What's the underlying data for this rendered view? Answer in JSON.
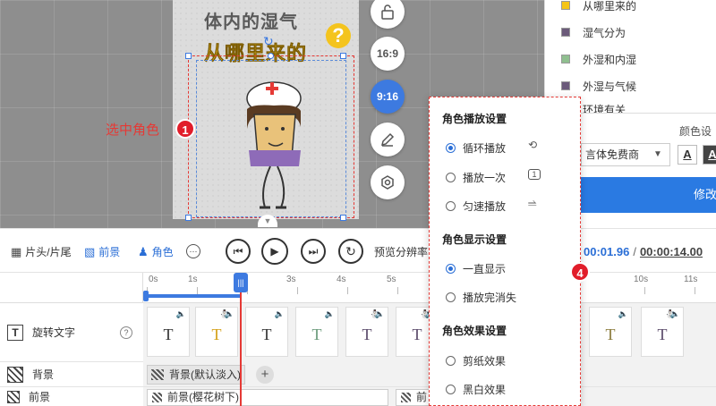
{
  "stage": {
    "title_line1": "体内的湿气",
    "title_line2": "从哪里来的",
    "question_mark": "?",
    "select_label": "选中角色",
    "badge1": "1"
  },
  "aspect_buttons": {
    "ratio_169": "16:9",
    "ratio_916": "9:16"
  },
  "right_panel": {
    "legend": [
      {
        "label": "从哪里来的",
        "color": "#f5c518"
      },
      {
        "label": "湿气分为",
        "color": "#6b5a7a"
      },
      {
        "label": "外湿和内湿",
        "color": "#8fbf8f"
      },
      {
        "label": "外湿与气候",
        "color": "#6b5a7a"
      },
      {
        "label": "环境有关",
        "color": "#6b5a7a"
      }
    ],
    "color_label": "颜色设",
    "font_value": "言体免费商",
    "font_style_a": "A",
    "apply_label": "修改"
  },
  "toolbar": {
    "header_footer": "片头/片尾",
    "foreground": "前景",
    "role": "角色",
    "more": "···",
    "preview_label": "预览分辨率",
    "current_time": "00:01.96",
    "separator": "/",
    "total_time": "00:00:14.00"
  },
  "timeline": {
    "ticks": [
      "0s",
      "1s",
      "3s",
      "4s",
      "5s",
      "10s",
      "11s"
    ],
    "playhead": "|||",
    "tracks": {
      "text": "旋转文字",
      "text_help": "?",
      "background": "背景",
      "foreground": "前景"
    },
    "text_clip_glyph": "T",
    "bg_clip": "背景(默认淡入)",
    "bg_add": "+",
    "fg_clip1": "前景(樱花树下)",
    "fg_clip2": "前"
  },
  "popup": {
    "section_play": "角色播放设置",
    "loop": "循环播放",
    "play_once": "播放一次",
    "uniform": "匀速播放",
    "section_display": "角色显示设置",
    "always_show": "一直显示",
    "hide_after": "播放完消失",
    "section_effect": "角色效果设置",
    "paper_cut": "剪纸效果",
    "black_white": "黑白效果",
    "badge4": "4",
    "once_icon": "1"
  }
}
